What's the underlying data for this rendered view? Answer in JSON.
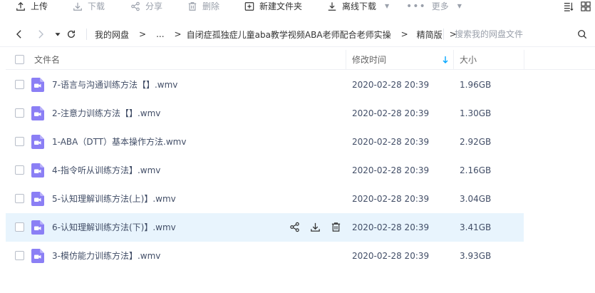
{
  "toolbar": {
    "upload": "上传",
    "download": "下载",
    "share": "分享",
    "delete": "删除",
    "new_folder": "新建文件夹",
    "offline_download": "离线下载",
    "more": "更多"
  },
  "nav": {
    "crumbs": [
      "我的网盘",
      "...",
      "自闭症孤独症儿童aba教学视频ABA老师配合老师实操",
      "精简版"
    ],
    "separator": ">",
    "search_placeholder": "搜索我的网盘文件"
  },
  "table": {
    "headers": {
      "name": "文件名",
      "modified": "修改时间",
      "size": "大小"
    },
    "rows": [
      {
        "name": "7-语言与沟通训练方法【】.wmv",
        "modified": "2020-02-28 20:39",
        "size": "1.96GB"
      },
      {
        "name": "2-注意力训练方法【】.wmv",
        "modified": "2020-02-28 20:39",
        "size": "1.30GB"
      },
      {
        "name": "1-ABA（DTT）基本操作方法.wmv",
        "modified": "2020-02-28 20:39",
        "size": "2.92GB"
      },
      {
        "name": "4-指令听从训练方法】.wmv",
        "modified": "2020-02-28 20:39",
        "size": "2.16GB"
      },
      {
        "name": "5-认知理解训练方法(上)】.wmv",
        "modified": "2020-02-28 20:39",
        "size": "3.04GB"
      },
      {
        "name": "6-认知理解训练方法(下)】.wmv",
        "modified": "2020-02-28 20:39",
        "size": "3.41GB"
      },
      {
        "name": "3-模仿能力训练方法】.wmv",
        "modified": "2020-02-28 20:39",
        "size": "3.93GB"
      }
    ],
    "hovered_row": 5
  },
  "icons": {
    "upload": "upload-icon",
    "download": "download-icon",
    "share": "share-icon",
    "delete": "trash-icon",
    "new_folder": "folder-plus-icon",
    "offline": "offline-download-icon",
    "more": "more-dots-icon",
    "file": "video-file-icon"
  },
  "colors": {
    "accent": "#06a7ff",
    "video_icon": "#8b7ff5",
    "row_hover": "#e8f4fd",
    "text": "#424e67",
    "muted": "#9aa0ab"
  }
}
